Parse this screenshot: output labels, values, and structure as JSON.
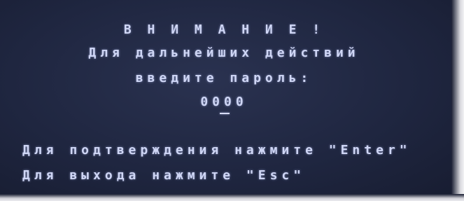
{
  "dialog": {
    "title": "В Н И М А Н И Е !",
    "message_line_1": "Для дальнейших действий",
    "message_line_2": "введите пароль:",
    "password_value": "0000",
    "hint_confirm": "Для подтверждения нажмите \"Enter\"",
    "hint_exit": "Для выхода нажмите \"Esc\""
  },
  "colors": {
    "background": "#1f2640",
    "text": "#cfd6f5"
  }
}
